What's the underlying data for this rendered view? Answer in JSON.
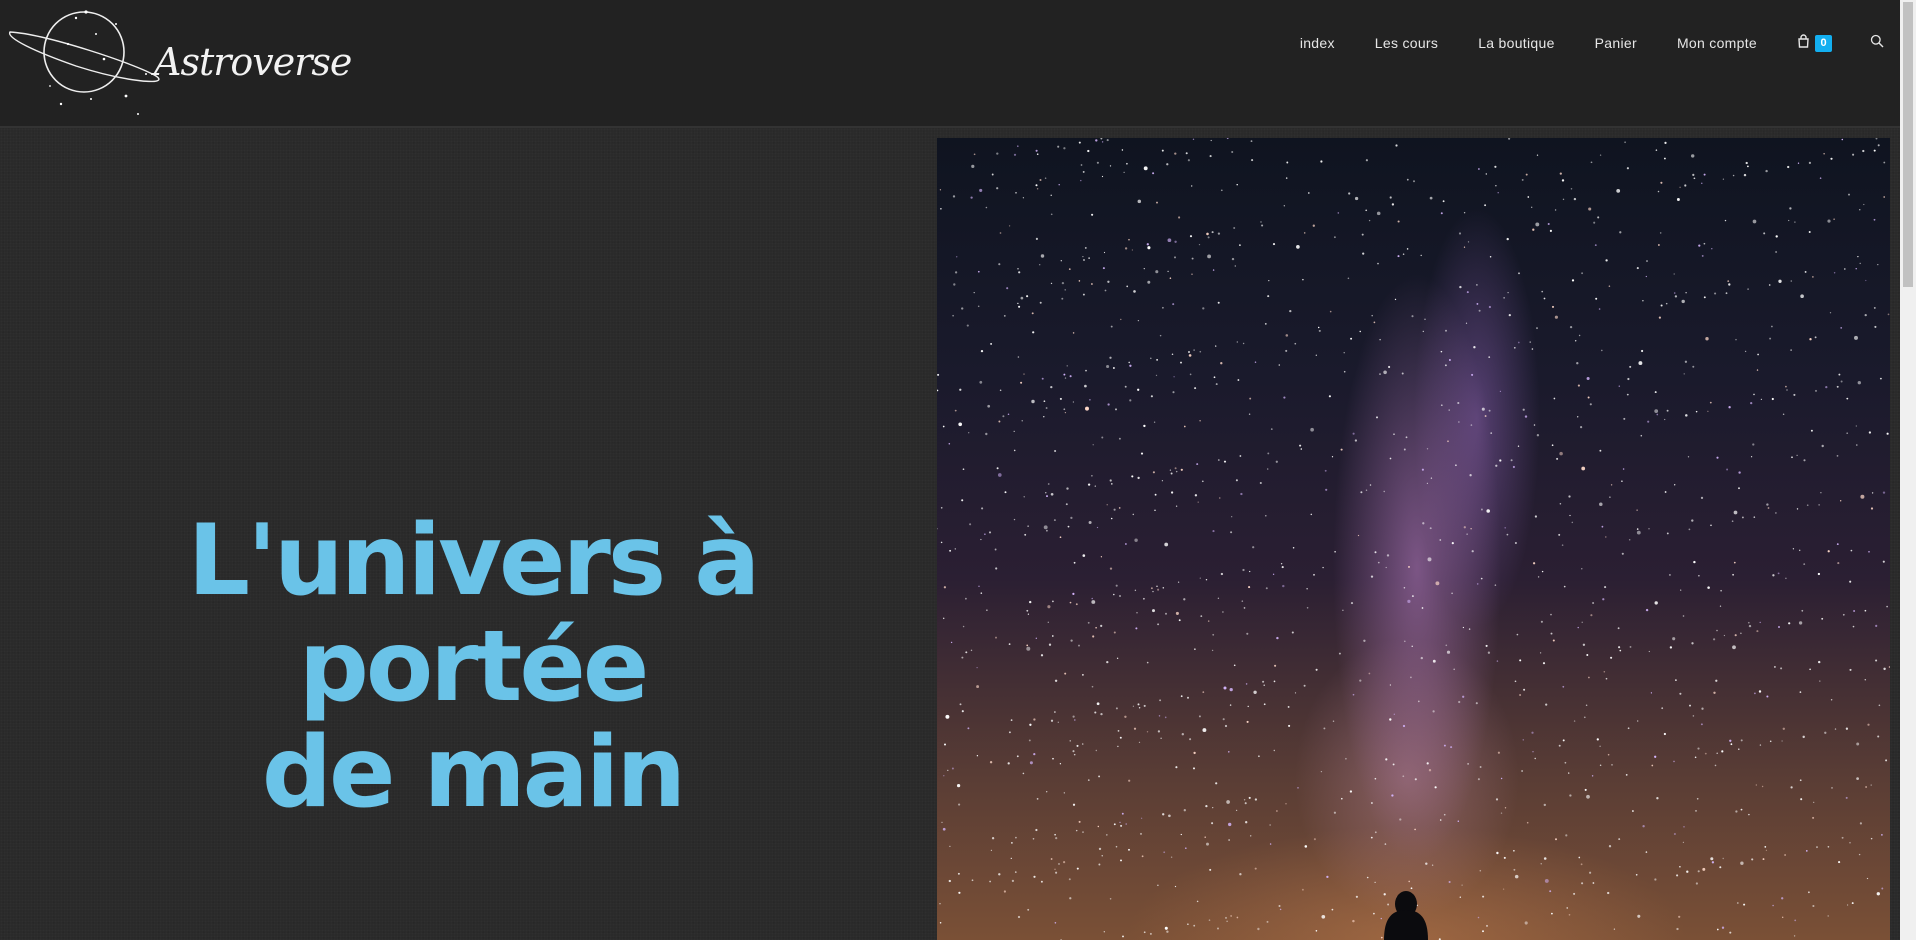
{
  "brand": {
    "name": "Astroverse",
    "logo_icon": "planet-ring-logo"
  },
  "nav": {
    "items": [
      {
        "label": "index"
      },
      {
        "label": "Les cours"
      },
      {
        "label": "La boutique"
      },
      {
        "label": "Panier"
      },
      {
        "label": "Mon compte"
      }
    ],
    "cart_icon": "shopping-bag-icon",
    "cart_count": "0",
    "search_icon": "search-icon"
  },
  "hero": {
    "title_line1": "L'univers à portée",
    "title_line2": "de main",
    "image_description_icon": "night-sky-milky-way-image"
  },
  "colors": {
    "header_bg": "#222222",
    "page_bg": "#2a2a2a",
    "title_color": "#6ac3e8",
    "accent": "#13aff0"
  }
}
